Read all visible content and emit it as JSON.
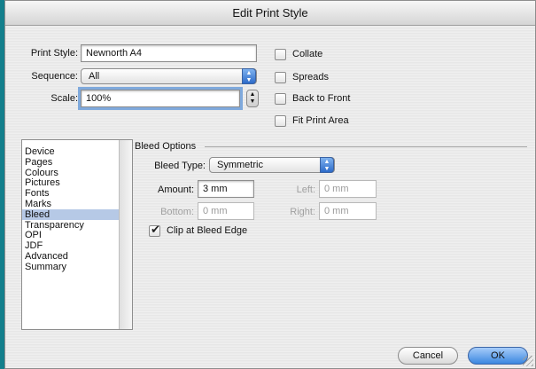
{
  "window": {
    "title": "Edit Print Style"
  },
  "top": {
    "print_style_label": "Print Style:",
    "print_style_value": "Newnorth A4",
    "sequence_label": "Sequence:",
    "sequence_value": "All",
    "scale_label": "Scale:",
    "scale_value": "100%"
  },
  "options": {
    "collate": {
      "label": "Collate",
      "checked": false
    },
    "spreads": {
      "label": "Spreads",
      "checked": false
    },
    "back_to_front": {
      "label": "Back to Front",
      "checked": false
    },
    "fit_print_area": {
      "label": "Fit Print Area",
      "checked": false
    }
  },
  "sidebar": {
    "selected_index": 6,
    "items": [
      {
        "label": "Device"
      },
      {
        "label": "Pages"
      },
      {
        "label": "Colours"
      },
      {
        "label": "Pictures"
      },
      {
        "label": "Fonts"
      },
      {
        "label": "Marks"
      },
      {
        "label": "Bleed"
      },
      {
        "label": "Transparency"
      },
      {
        "label": "OPI"
      },
      {
        "label": "JDF"
      },
      {
        "label": "Advanced"
      },
      {
        "label": "Summary"
      }
    ]
  },
  "bleed": {
    "section_title": "Bleed Options",
    "type_label": "Bleed Type:",
    "type_value": "Symmetric",
    "amount_label": "Amount:",
    "amount_value": "3 mm",
    "left_label": "Left:",
    "left_value": "0 mm",
    "bottom_label": "Bottom:",
    "bottom_value": "0 mm",
    "right_label": "Right:",
    "right_value": "0 mm",
    "clip_label": "Clip at Bleed Edge",
    "clip_checked": true
  },
  "buttons": {
    "cancel": "Cancel",
    "ok": "OK"
  },
  "colors": {
    "accent": "#3a86e0",
    "selection": "#b6c9e6",
    "desktop": "#137f8c"
  }
}
